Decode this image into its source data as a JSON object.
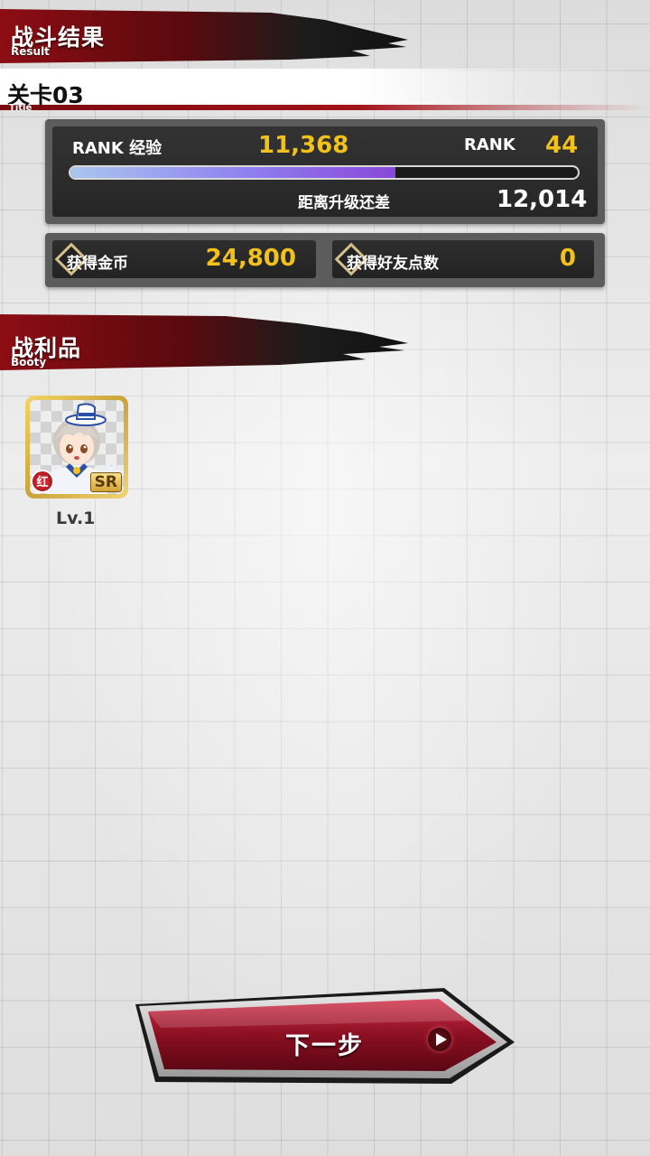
{
  "result_banner": {
    "title": "战斗结果",
    "subtitle": "Result"
  },
  "stage": {
    "title": "关卡03",
    "subtitle": "Title"
  },
  "rank_panel": {
    "exp_label": "RANK 经验",
    "exp_value": "11,368",
    "rank_label": "RANK",
    "rank_value": "44",
    "progress_fraction": 0.64,
    "remaining_label": "距离升级还差",
    "remaining_value": "12,014"
  },
  "rewards": {
    "coins_label": "获得金币",
    "coins_value": "24,800",
    "friend_label": "获得好友点数",
    "friend_value": "0"
  },
  "booty_banner": {
    "title": "战利品",
    "subtitle": "Booty"
  },
  "booty_items": [
    {
      "rarity": "SR",
      "element_badge": "红",
      "level": "Lv.1"
    }
  ],
  "next_button": {
    "label": "下一步",
    "icon": "play-arrow-icon"
  },
  "colors": {
    "accent_red": "#a11219",
    "gold": "#f3c21a",
    "panel_dark": "#2a2a2a"
  }
}
